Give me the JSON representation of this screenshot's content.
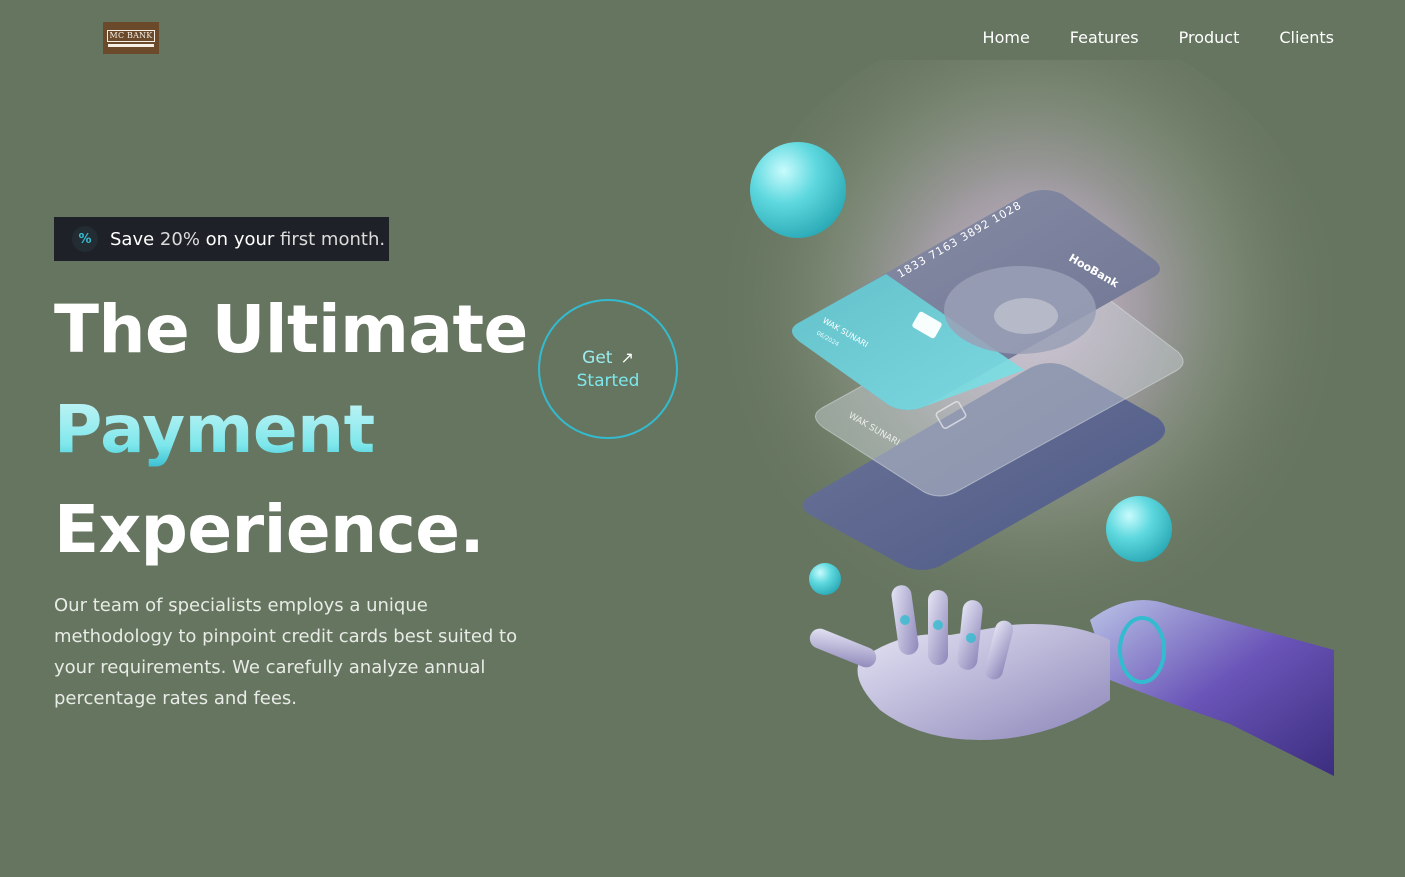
{
  "brand": {
    "logo_text": "MC BANK"
  },
  "nav": {
    "items": [
      {
        "label": "Home"
      },
      {
        "label": "Features"
      },
      {
        "label": "Product"
      },
      {
        "label": "Clients"
      }
    ]
  },
  "promo": {
    "icon": "discount-icon",
    "save": "Save",
    "percent": "20%",
    "on_your": "on your",
    "first_month": "first month."
  },
  "headline": {
    "line1": "The Ultimate",
    "line2": "Payment",
    "line3": "Experience."
  },
  "cta": {
    "get": "Get",
    "started": "Started",
    "icon": "arrow-up-right-icon"
  },
  "description": "Our team of specialists employs a unique methodology to pinpoint credit cards best suited to your requirements. We carefully analyze annual percentage rates and fees.",
  "hero_cards": {
    "card_number": "1833 7163 3892 1028",
    "brand": "HooBank",
    "holder": "WAK SUNARI",
    "expiry": "06/2024"
  },
  "colors": {
    "background": "#667560",
    "accent": "#33bbcf",
    "accent_light": "#9dedf0",
    "promo_bg": "#1f2128",
    "logo_bg": "#6b4a2c"
  }
}
